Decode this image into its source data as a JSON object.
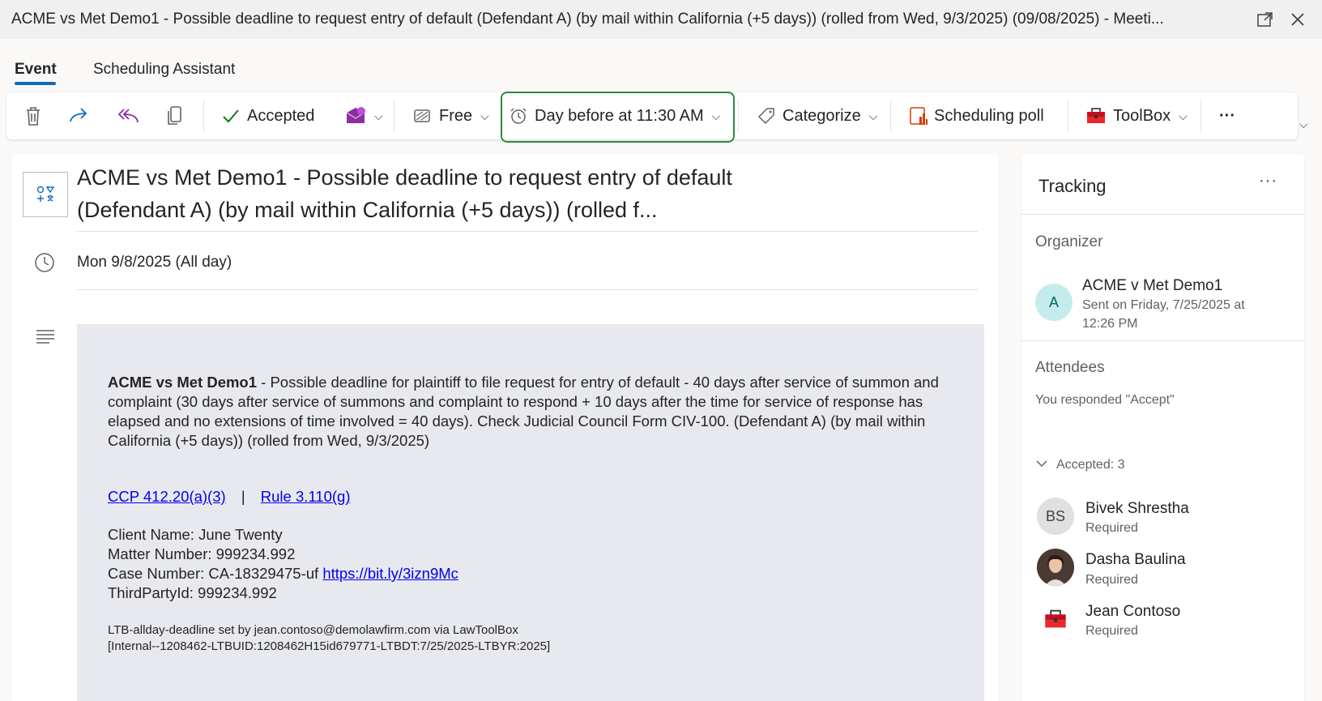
{
  "window": {
    "title": "ACME vs Met Demo1 - Possible deadline to request entry of default (Defendant A) (by mail within California (+5 days)) (rolled from Wed, 9/3/2025) (09/08/2025) - Meeti..."
  },
  "tabs": [
    {
      "label": "Event",
      "active": true
    },
    {
      "label": "Scheduling Assistant",
      "active": false
    }
  ],
  "toolbar": {
    "accepted_label": "Accepted",
    "show_as_label": "Free",
    "reminder_label": "Day before at 11:30 AM",
    "categorize_label": "Categorize",
    "scheduling_poll_label": "Scheduling poll",
    "toolbox_label": "ToolBox",
    "more_label": "···"
  },
  "event": {
    "subject": "ACME vs Met Demo1 - Possible deadline to request entry of default (Defendant A) (by mail within California (+5 days)) (rolled f...",
    "date": "Mon 9/8/2025 (All day)"
  },
  "body": {
    "bold_lead": "ACME vs Met Demo1",
    "description": " - Possible deadline for plaintiff to file request for entry of default - 40 days after service of summon and complaint (30 days after service of summons and complaint to respond + 10 days after the time for service of response has elapsed and no extensions of time involved = 40 days). Check Judicial Council Form CIV-100. (Defendant A) (by mail within California (+5 days)) (rolled from Wed, 9/3/2025)",
    "link1": "CCP 412.20(a)(3)",
    "link_sep": "|",
    "link2": "Rule 3.110(g)",
    "client_name": "Client Name: June Twenty",
    "matter_number": "Matter Number: 999234.992",
    "case_number_prefix": "Case Number: CA-18329475-uf ",
    "case_link": "https://bit.ly/3izn9Mc",
    "third_party": "ThirdPartyId: 999234.992",
    "footer_line1": "LTB-allday-deadline set by jean.contoso@demolawfirm.com via LawToolBox",
    "footer_line2": "[Internal--1208462-LTBUID:1208462H15id679771-LTBDT:7/25/2025-LTBYR:2025]"
  },
  "tracking": {
    "title": "Tracking",
    "more": "···",
    "organizer_heading": "Organizer",
    "organizer": {
      "initial": "A",
      "name": "ACME v Met Demo1",
      "sent": "Sent on Friday, 7/25/2025 at 12:26 PM"
    },
    "attendees_heading": "Attendees",
    "response_status": "You responded \"Accept\"",
    "accepted_group": "Accepted: 3",
    "attendees": [
      {
        "initials": "BS",
        "name": "Bivek Shrestha",
        "role": "Required"
      },
      {
        "initials": "",
        "name": "Dasha Baulina",
        "role": "Required"
      },
      {
        "initials": "",
        "name": "Jean Contoso",
        "role": "Required"
      }
    ]
  },
  "colors": {
    "accent": "#0f6cbd",
    "highlight": "#2a8a3e",
    "organizer_avatar_bg": "#c5ecec",
    "organizer_avatar_fg": "#006666"
  }
}
